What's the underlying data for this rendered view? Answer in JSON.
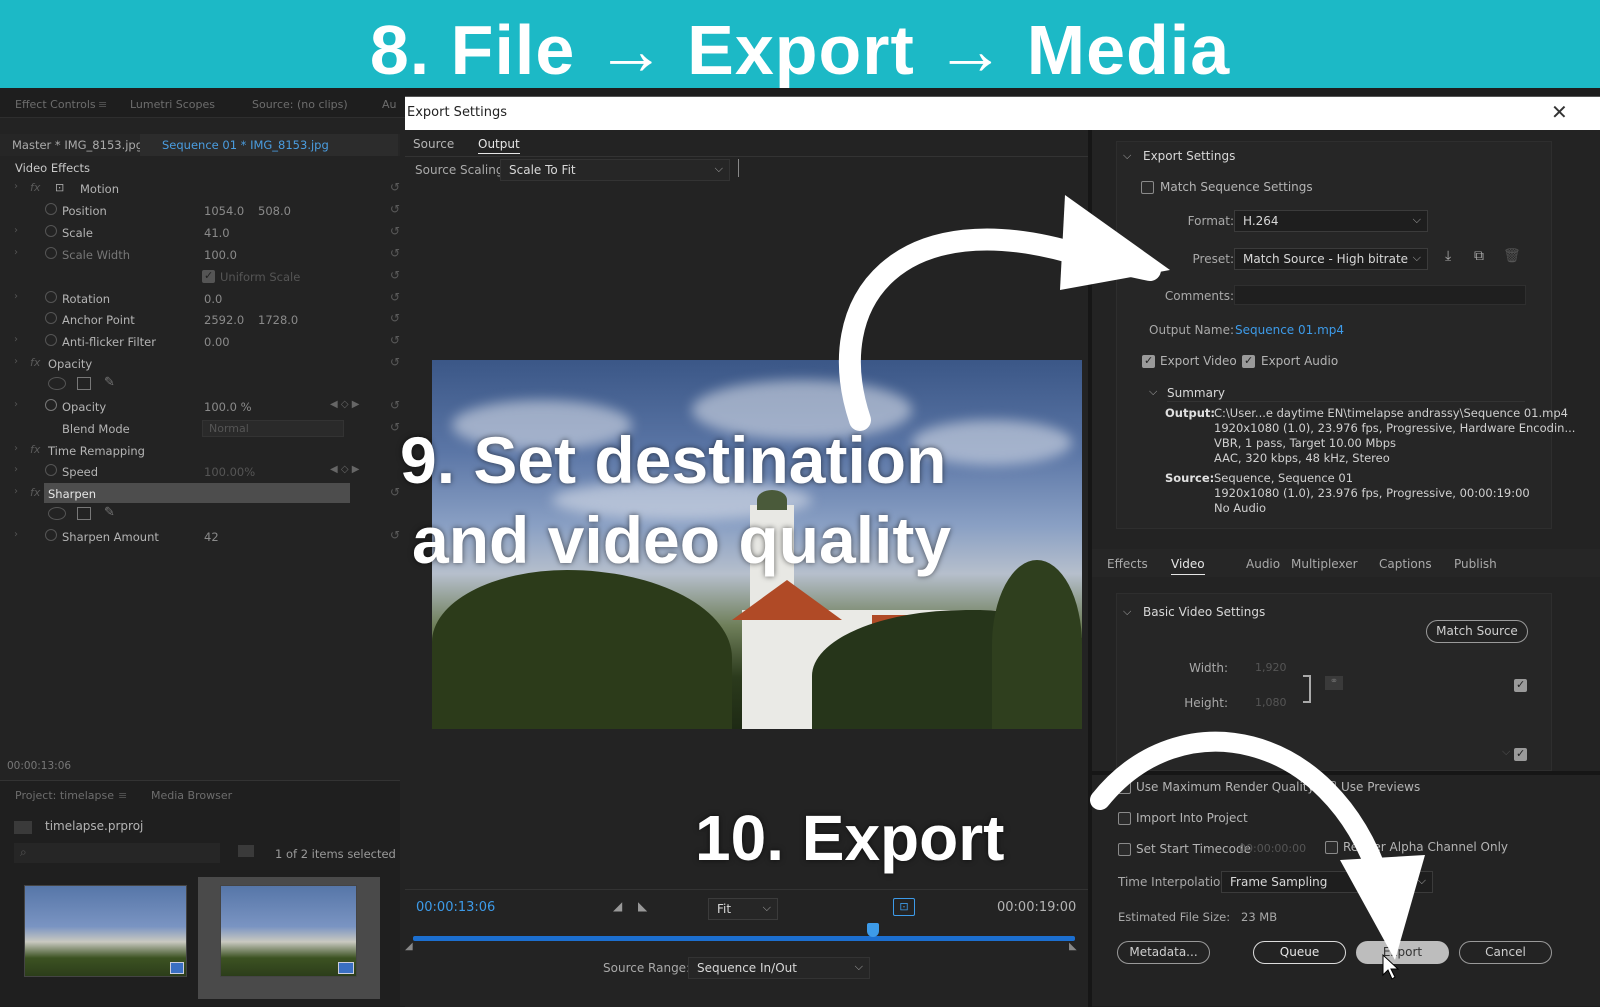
{
  "banner": {
    "title": "8. File → Export → Media"
  },
  "left_panel": {
    "tabs": [
      "Effect Controls",
      "Lumetri Scopes",
      "Source: (no clips)",
      "Au"
    ],
    "master_label": "Master * IMG_8153.jpg",
    "sequence_label": "Sequence 01 * IMG_8153.jpg",
    "video_effects_label": "Video Effects",
    "motion_label": "Motion",
    "rows": {
      "position": {
        "label": "Position",
        "v1": "1054.0",
        "v2": "508.0"
      },
      "scale": {
        "label": "Scale",
        "v1": "41.0"
      },
      "scale_width": {
        "label": "Scale Width",
        "v1": "100.0"
      },
      "uniform_scale": {
        "label": "Uniform Scale"
      },
      "rotation": {
        "label": "Rotation",
        "v1": "0.0"
      },
      "anchor_point": {
        "label": "Anchor Point",
        "v1": "2592.0",
        "v2": "1728.0"
      },
      "anti_flicker": {
        "label": "Anti-flicker Filter",
        "v1": "0.00"
      },
      "opacity_group": {
        "label": "Opacity"
      },
      "opacity": {
        "label": "Opacity",
        "v1": "100.0 %"
      },
      "blend_mode": {
        "label": "Blend Mode",
        "v1": "Normal"
      },
      "time_remap": {
        "label": "Time Remapping"
      },
      "speed": {
        "label": "Speed",
        "v1": "100.00%"
      },
      "sharpen": {
        "label": "Sharpen"
      },
      "sharpen_amount": {
        "label": "Sharpen Amount",
        "v1": "42"
      }
    },
    "timecode": "00:00:13:06",
    "project_tabs": [
      "Project: timelapse",
      "Media Browser"
    ],
    "project_file": "timelapse.prproj",
    "items_selected": "1 of 2 items selected"
  },
  "dialog": {
    "title": "Export Settings",
    "tabs": {
      "source": "Source",
      "output": "Output"
    },
    "source_scaling_label": "Source Scaling:",
    "source_scaling_value": "Scale To Fit",
    "timecode_current": "00:00:13:06",
    "timecode_end": "00:00:19:00",
    "fit_value": "Fit",
    "source_range_label": "Source Range:",
    "source_range_value": "Sequence In/Out",
    "export_settings": {
      "heading": "Export Settings",
      "match_sequence": "Match Sequence Settings",
      "format_label": "Format:",
      "format_value": "H.264",
      "preset_label": "Preset:",
      "preset_value": "Match Source - High bitrate",
      "comments_label": "Comments:",
      "output_name_label": "Output Name:",
      "output_name_value": "Sequence 01.mp4",
      "export_video": "Export Video",
      "export_audio": "Export Audio",
      "summary_heading": "Summary",
      "output_key": "Output:",
      "output_lines": "C:\\User...e daytime EN\\timelapse andrassy\\Sequence 01.mp4\n1920x1080 (1.0), 23.976 fps, Progressive, Hardware Encodin...\nVBR, 1 pass, Target 10.00 Mbps\nAAC, 320 kbps, 48 kHz, Stereo",
      "source_key": "Source:",
      "source_lines": "Sequence, Sequence 01\n1920x1080 (1.0), 23.976 fps, Progressive, 00:00:19:00\nNo Audio"
    },
    "settings_tabs": [
      "Effects",
      "Video",
      "Audio",
      "Multiplexer",
      "Captions",
      "Publish"
    ],
    "basic_video": {
      "heading": "Basic Video Settings",
      "match_source": "Match Source",
      "width_label": "Width:",
      "width_value": "1,920",
      "height_label": "Height:",
      "height_value": "1,080"
    },
    "options": {
      "max_render": "Use Maximum Render Quality",
      "use_previews": "Use Previews",
      "import_project": "Import Into Project",
      "set_start_tc": "Set Start Timecode",
      "start_tc_value": "00:00:00:00",
      "alpha_only": "Render Alpha Channel Only",
      "time_interp_label": "Time Interpolation:",
      "time_interp_value": "Frame Sampling",
      "file_size_label": "Estimated File Size:",
      "file_size_value": "23 MB"
    },
    "buttons": {
      "metadata": "Metadata...",
      "queue": "Queue",
      "export": "Export",
      "cancel": "Cancel"
    }
  },
  "annotations": {
    "step9_line1": "9. Set destination",
    "step9_line2": "and video quality",
    "step10": "10. Export"
  },
  "colors": {
    "banner": "#1cb9c6",
    "accent_blue": "#3d9be9",
    "panel": "#232323"
  }
}
